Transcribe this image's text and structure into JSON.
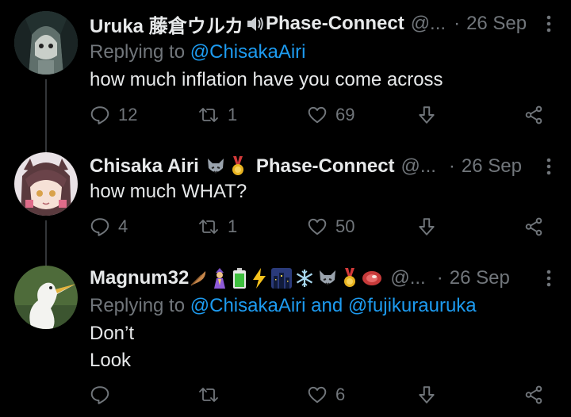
{
  "tweets": [
    {
      "name": "Uruka 藤倉ウルカ",
      "name_suffix": "Phase-Connect",
      "name_emojis": [
        "speaker-icon"
      ],
      "handle": "@...",
      "separator": "·",
      "date": "26 Sep",
      "replying_prefix": "Replying to",
      "replying_mentions": [
        "@ChisakaAiri"
      ],
      "text_lines": [
        "how much inflation have you come across"
      ],
      "replies": "12",
      "retweets": "1",
      "likes": "69"
    },
    {
      "name": "Chisaka Airi",
      "name_suffix": "Phase-Connect",
      "name_emojis": [
        "wolf-emoji",
        "medal-emoji"
      ],
      "handle": "@...",
      "separator": "·",
      "date": "26 Sep",
      "text_lines": [
        "how much WHAT?"
      ],
      "replies": "4",
      "retweets": "1",
      "likes": "50"
    },
    {
      "name": "Magnum32",
      "name_emojis": [
        "feather-emoji",
        "mage-emoji",
        "battery-emoji",
        "lightning-emoji",
        "city-night-emoji",
        "snowflake-emoji",
        "wolf-emoji",
        "medal-emoji",
        "meat-emoji"
      ],
      "handle": "@...",
      "separator": "·",
      "date": "26 Sep",
      "replying_prefix": "Replying to",
      "replying_mentions": [
        "@ChisakaAiri",
        "@fujikurauruka"
      ],
      "replying_joiner": "and",
      "text_lines": [
        "Don’t",
        "Look"
      ],
      "replies": "",
      "retweets": "",
      "likes": "6"
    }
  ],
  "colors": {
    "background": "#000000",
    "text": "#e7e9ea",
    "muted": "#71767b",
    "link": "#1d9bf0",
    "thread_line": "#333639"
  }
}
